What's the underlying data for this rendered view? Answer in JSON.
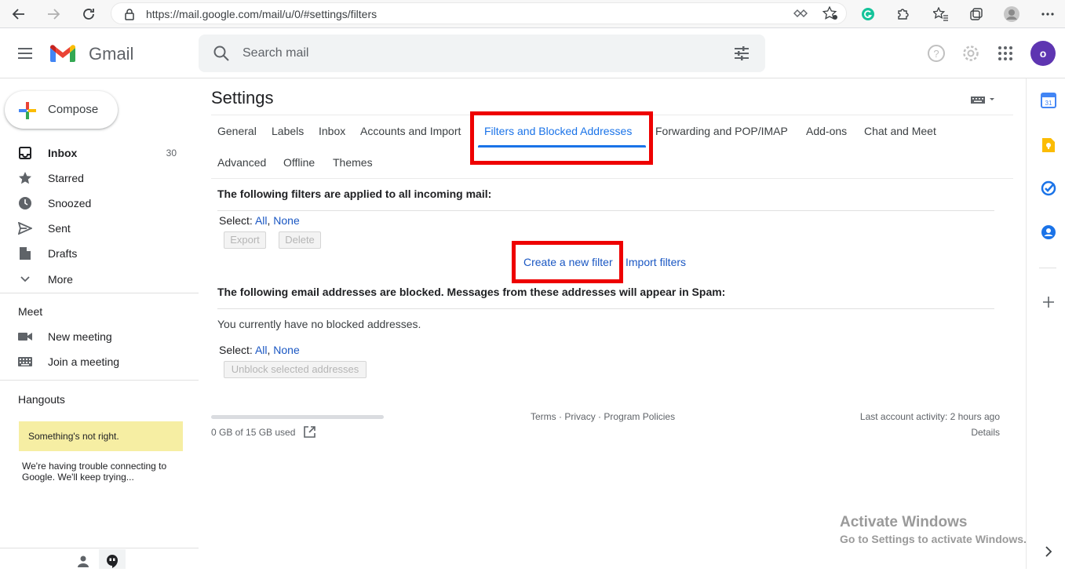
{
  "browser": {
    "url": "https://mail.google.com/mail/u/0/#settings/filters",
    "profile_colors": {
      "grammarly": "#15c39a"
    }
  },
  "header": {
    "app_name": "Gmail",
    "search_placeholder": "Search mail",
    "avatar_letter": "o",
    "avatar_color": "#5e35b1"
  },
  "sidebar": {
    "compose_label": "Compose",
    "items": [
      {
        "label": "Inbox",
        "count": "30",
        "icon": "inbox-icon"
      },
      {
        "label": "Starred",
        "icon": "star-icon"
      },
      {
        "label": "Snoozed",
        "icon": "clock-icon"
      },
      {
        "label": "Sent",
        "icon": "send-icon"
      },
      {
        "label": "Drafts",
        "icon": "draft-icon"
      },
      {
        "label": "More",
        "icon": "chevron-down-icon"
      }
    ],
    "meet": {
      "heading": "Meet",
      "items": [
        {
          "label": "New meeting",
          "icon": "video-icon"
        },
        {
          "label": "Join a meeting",
          "icon": "keyboard-icon"
        }
      ]
    },
    "hangouts": {
      "heading": "Hangouts",
      "error_banner": "Something's not right.",
      "error_text": "We're having trouble connecting to Google. We'll keep trying..."
    }
  },
  "settings": {
    "title": "Settings",
    "tabs_row1": [
      "General",
      "Labels",
      "Inbox",
      "Accounts and Import",
      "Filters and Blocked Addresses",
      "Forwarding and POP/IMAP",
      "Add-ons",
      "Chat and Meet"
    ],
    "tabs_row2": [
      "Advanced",
      "Offline",
      "Themes"
    ],
    "active_tab": "Filters and Blocked Addresses",
    "filters_heading": "The following filters are applied to all incoming mail:",
    "select_label": "Select:",
    "select_all": "All",
    "select_none": "None",
    "export_label": "Export",
    "delete_label": "Delete",
    "create_filter": "Create a new filter",
    "import_filters": "Import filters",
    "blocked_heading": "The following email addresses are blocked. Messages from these addresses will appear in Spam:",
    "no_blocked": "You currently have no blocked addresses.",
    "unblock_label": "Unblock selected addresses"
  },
  "footer": {
    "storage": "0 GB of 15 GB used",
    "terms": "Terms",
    "privacy": "Privacy",
    "program_policies": "Program Policies",
    "sep": "·",
    "last_activity": "Last account activity: 2 hours ago",
    "details": "Details"
  },
  "watermark": {
    "title": "Activate Windows",
    "subtitle": "Go to Settings to activate Windows."
  },
  "colors": {
    "accent_blue": "#1a73e8",
    "link_blue": "#1a57c3",
    "highlight_red": "#ee0000",
    "error_yellow": "#f6eea3"
  }
}
